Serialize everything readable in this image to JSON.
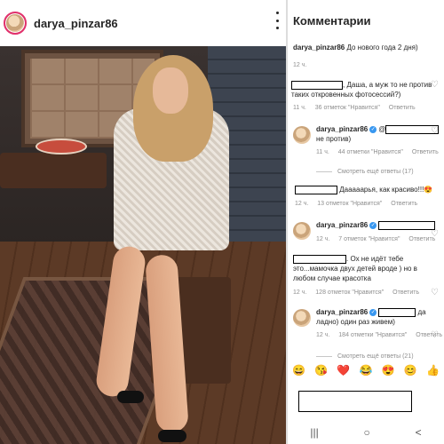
{
  "post": {
    "username": "darya_pinzar86"
  },
  "comments_panel": {
    "title": "Комментарии",
    "caption": {
      "username": "darya_pinzar86",
      "text": "До нового года 2 дня)",
      "time": "12 ч."
    },
    "items": [
      {
        "text": ", Даша, а муж то не против таких откровенных фотосессий?)",
        "time": "11 ч.",
        "likes": "36 отметок \"Нравится\"",
        "reply": "Ответить"
      },
      {
        "username": "darya_pinzar86",
        "text_pre": "@",
        "text_post": "не против)",
        "time": "11 ч.",
        "likes": "44 отметки \"Нравится\"",
        "reply": "Ответить",
        "view_more": "Смотреть ещё ответы (17)"
      },
      {
        "text": "Дааааарья, как красиво!!!",
        "time": "12 ч.",
        "likes": "13 отметок \"Нравится\"",
        "reply": "Ответить"
      },
      {
        "username": "darya_pinzar86",
        "time": "12 ч.",
        "likes": "7 отметок \"Нравится\"",
        "reply": "Ответить"
      },
      {
        "text": ". Ох не идёт тебе это...мамочка двух детей вроде ) но в любом случае красотка",
        "time": "12 ч.",
        "likes": "128 отметок \"Нравится\"",
        "reply": "Ответить"
      },
      {
        "username": "darya_pinzar86",
        "text_post": "да ладно) один раз живем)",
        "time": "12 ч.",
        "likes": "184 отметки \"Нравится\"",
        "reply": "Ответить",
        "view_more": "Смотреть ещё ответы (21)"
      }
    ],
    "emojis": [
      "😄",
      "😘",
      "❤️",
      "😂",
      "😍",
      "😊",
      "👍"
    ],
    "nav": [
      "|||",
      "○",
      "<"
    ]
  }
}
